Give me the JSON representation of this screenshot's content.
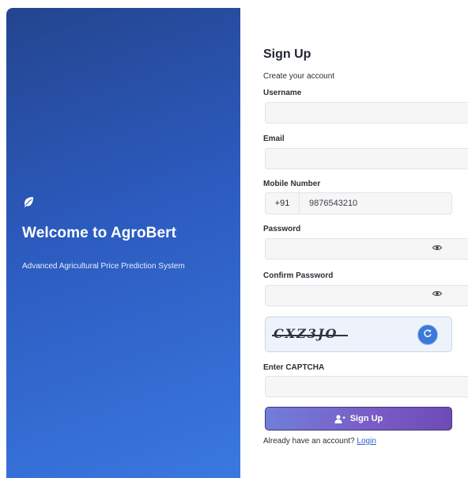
{
  "brand": {
    "title": "Welcome to AgroBert",
    "subtitle": "Advanced Agricultural Price Prediction System",
    "icon": "leaf-icon"
  },
  "form": {
    "title": "Sign Up",
    "subtitle": "Create your account",
    "username": {
      "label": "Username",
      "value": ""
    },
    "email": {
      "label": "Email",
      "value": ""
    },
    "mobile": {
      "label": "Mobile Number",
      "prefix": "+91",
      "value": "9876543210"
    },
    "password": {
      "label": "Password",
      "value": "",
      "toggle_icon": "eye-icon"
    },
    "confirm_password": {
      "label": "Confirm Password",
      "value": "",
      "toggle_icon": "eye-icon"
    },
    "captcha": {
      "code": "CXZ3JO",
      "refresh_icon": "refresh-icon"
    },
    "captcha_input": {
      "label": "Enter CAPTCHA",
      "value": ""
    },
    "submit": {
      "label": "Sign Up",
      "icon": "add-user-icon"
    },
    "login_prompt": "Already have an account?",
    "login_link": "Login"
  },
  "colors": {
    "brand_gradient_start": "#24458f",
    "brand_gradient_end": "#3a78e0",
    "button_gradient_start": "#6f7fd9",
    "button_gradient_end": "#6e4bb7",
    "link": "#2f63c8"
  }
}
